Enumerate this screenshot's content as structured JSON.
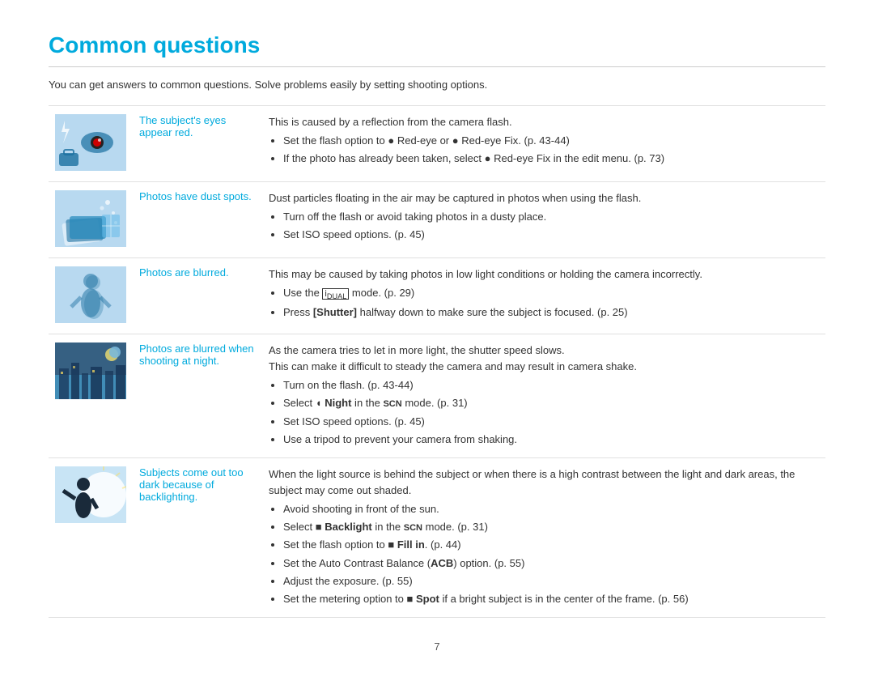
{
  "page": {
    "title": "Common questions",
    "subtitle": "You can get answers to common questions. Solve problems easily by setting shooting options.",
    "page_number": "7"
  },
  "faq": [
    {
      "id": "red-eye",
      "label": "The subject's eyes appear red.",
      "image_bg": "#b8d9f0",
      "description_intro": "This is caused by a reflection from the camera flash.",
      "bullets": [
        "Set the flash option to ● Red-eye or ● Red-eye Fix. (p. 43-44)",
        "If the photo has already been taken, select ● Red-eye Fix in the edit menu. (p. 73)"
      ]
    },
    {
      "id": "dust-spots",
      "label": "Photos have dust spots.",
      "image_bg": "#b8d9f0",
      "description_intro": "Dust particles floating in the air may be captured in photos when using the flash.",
      "bullets": [
        "Turn off the flash or avoid taking photos in a dusty place.",
        "Set ISO speed options. (p. 45)"
      ]
    },
    {
      "id": "blurred",
      "label": "Photos are blurred.",
      "image_bg": "#b8d9f0",
      "description_intro": "This may be caused by taking photos in low light conditions or holding the camera incorrectly.",
      "bullets": [
        "Use the ■DUAL mode. (p. 29)",
        "Press [Shutter] halfway down to make sure the subject is focused. (p. 25)"
      ]
    },
    {
      "id": "night-blur",
      "label": "Photos are blurred when shooting at night.",
      "image_bg": "#b8d9f0",
      "description_intro": "As the camera tries to let in more light, the shutter speed slows.\nThis can make it difficult to steady the camera and may result in camera shake.",
      "bullets": [
        "Turn on the flash. (p. 43-44)",
        "Select ◖ Night in the SCN mode. (p. 31)",
        "Set ISO speed options. (p. 45)",
        "Use a tripod to prevent your camera from shaking."
      ]
    },
    {
      "id": "backlight",
      "label": "Subjects come out too dark because of backlighting.",
      "image_bg": "#b8d9f0",
      "description_intro": "When the light source is behind the subject or when there is a high contrast between the light and dark areas, the subject may come out shaded.",
      "bullets": [
        "Avoid shooting in front of the sun.",
        "Select ■ Backlight in the SCN mode. (p. 31)",
        "Set the flash option to ■ Fill in. (p. 44)",
        "Set the Auto Contrast Balance (ACB) option. (p. 55)",
        "Adjust the exposure. (p. 55)",
        "Set the metering option to ■ Spot if a bright subject is in the center of the frame. (p. 56)"
      ]
    }
  ]
}
